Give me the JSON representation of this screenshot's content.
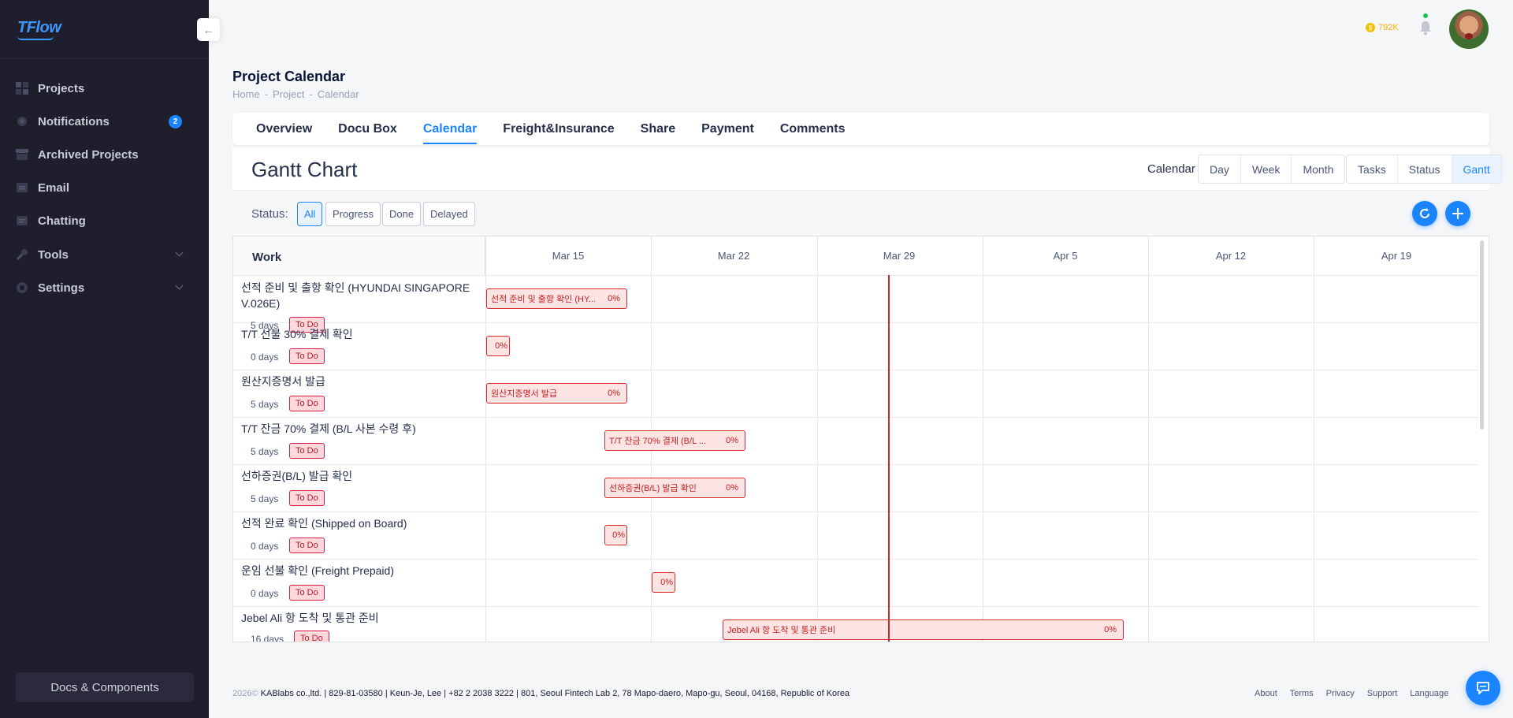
{
  "app": {
    "logo": "TFlow"
  },
  "sidebar": {
    "items": [
      {
        "label": "Projects",
        "icon": "grid-icon"
      },
      {
        "label": "Notifications",
        "icon": "notifications-icon",
        "badge": "2"
      },
      {
        "label": "Archived Projects",
        "icon": "archive-icon"
      },
      {
        "label": "Email",
        "icon": "email-icon"
      },
      {
        "label": "Chatting",
        "icon": "chat-icon"
      },
      {
        "label": "Tools",
        "icon": "wrench-icon"
      },
      {
        "label": "Settings",
        "icon": "settings-icon"
      }
    ],
    "docs_button": "Docs & Components"
  },
  "header": {
    "credits": "792K"
  },
  "page": {
    "title": "Project Calendar",
    "breadcrumb": [
      "Home",
      "Project",
      "Calendar"
    ]
  },
  "tabs": [
    "Overview",
    "Docu Box",
    "Calendar",
    "Freight&Insurance",
    "Share",
    "Payment",
    "Comments"
  ],
  "active_tab": "Calendar",
  "gantt": {
    "title": "Gantt Chart",
    "calendar_label": "Calendar",
    "range_buttons": [
      "Day",
      "Week",
      "Month"
    ],
    "view_buttons": [
      "Tasks",
      "Status",
      "Gantt"
    ],
    "active_view": "Gantt",
    "status_label": "Status:",
    "filters": [
      "All",
      "Progress",
      "Done",
      "Delayed"
    ],
    "active_filter": "All",
    "work_header": "Work",
    "dates": [
      "Mar 15",
      "Mar 22",
      "Mar 29",
      "Apr 5",
      "Apr 12",
      "Apr 19"
    ],
    "rows": [
      {
        "name": "선적 준비 및 출항 확인 (HYUNDAI SINGAPORE V.026E)",
        "days": "5 days",
        "status": "To Do",
        "bar_label": "선적 준비 및 출항 확인 (HY...",
        "pct": "0%"
      },
      {
        "name": "T/T 선불 30% 결제 확인",
        "days": "0 days",
        "status": "To Do",
        "bar_label": "",
        "pct": "0%"
      },
      {
        "name": "원산지증명서 발급",
        "days": "5 days",
        "status": "To Do",
        "bar_label": "원산지증명서 발급",
        "pct": "0%"
      },
      {
        "name": "T/T 잔금 70% 결제 (B/L 사본 수령 후)",
        "days": "5 days",
        "status": "To Do",
        "bar_label": "T/T 잔금 70% 결제 (B/L ...",
        "pct": "0%"
      },
      {
        "name": "선하증권(B/L) 발급 확인",
        "days": "5 days",
        "status": "To Do",
        "bar_label": "선하증권(B/L) 발급 확인",
        "pct": "0%"
      },
      {
        "name": "선적 완료 확인 (Shipped on Board)",
        "days": "0 days",
        "status": "To Do",
        "bar_label": "",
        "pct": "0%"
      },
      {
        "name": "운임 선불 확인 (Freight Prepaid)",
        "days": "0 days",
        "status": "To Do",
        "bar_label": "",
        "pct": "0%"
      },
      {
        "name": "Jebel Ali 항 도착 및 통관 준비",
        "days": "16 days",
        "status": "To Do",
        "bar_label": "Jebel Ali 항 도착 및 통관 준비",
        "pct": "0%"
      }
    ]
  },
  "footer": {
    "year": "2026©",
    "company": "KABlabs co.,ltd. | 829-81-03580 | Keun-Je, Lee | +82 2 2038 3222 | 801, Seoul Fintech Lab 2, 78 Mapo-daero, Mapo-gu, Seoul, 04168, Republic of Korea",
    "links": [
      "About",
      "Terms",
      "Privacy",
      "Support",
      "Language"
    ]
  },
  "colors": {
    "accent": "#1b84ff",
    "sidebar_bg": "#1e1e2d",
    "todo_bg": "#ffd8dc",
    "bar_border": "#d92a2a",
    "today_line": "#c62828"
  }
}
